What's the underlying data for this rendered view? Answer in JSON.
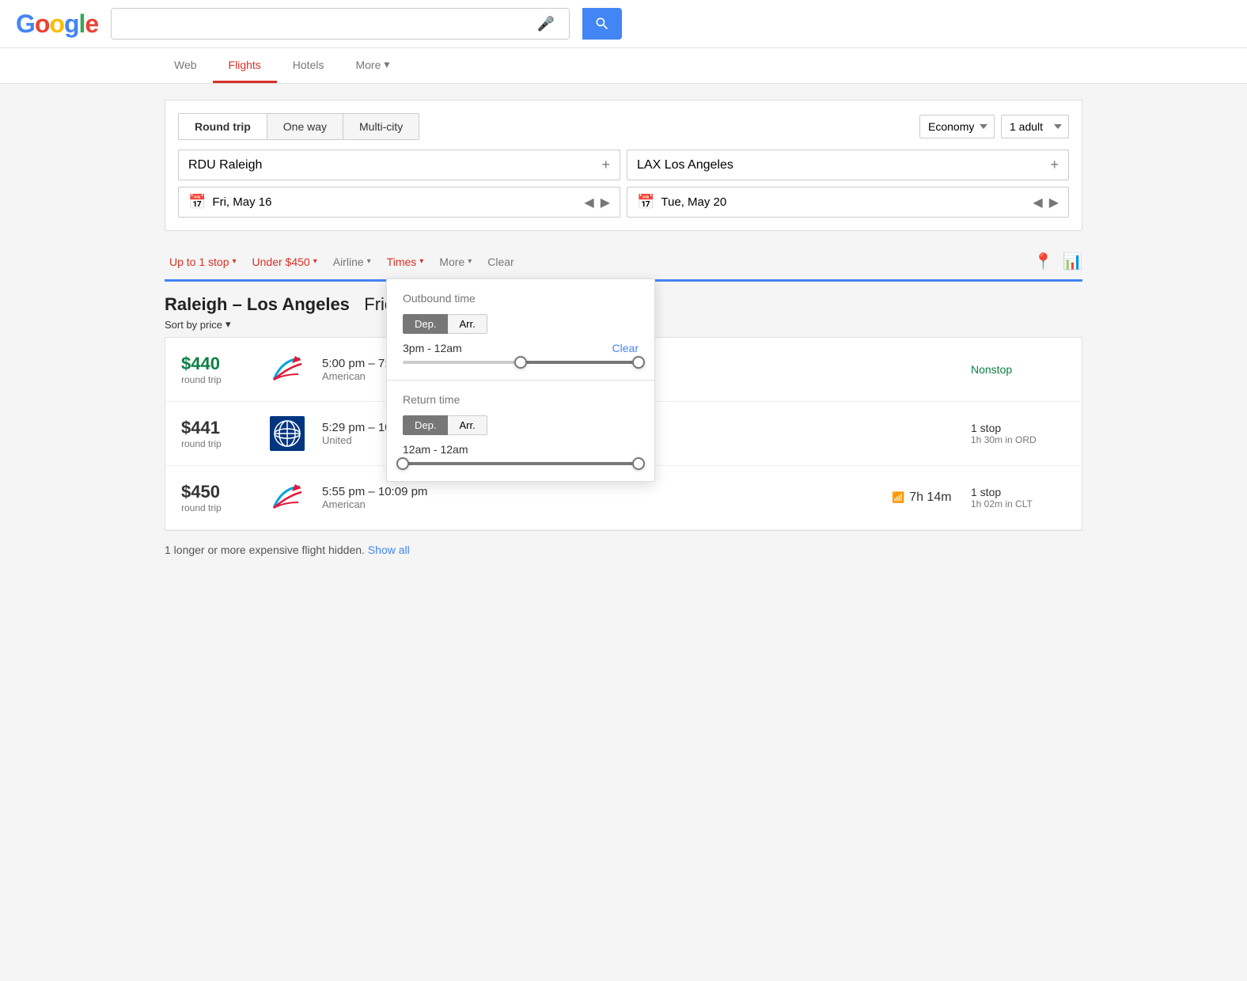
{
  "header": {
    "logo_text": "Google",
    "logo_letters": [
      "G",
      "o",
      "o",
      "g",
      "l",
      "e"
    ],
    "search_placeholder": ""
  },
  "nav": {
    "tabs": [
      {
        "label": "Web",
        "active": false
      },
      {
        "label": "Flights",
        "active": true
      },
      {
        "label": "Hotels",
        "active": false
      },
      {
        "label": "More",
        "active": false
      }
    ]
  },
  "flight_form": {
    "trip_types": [
      {
        "label": "Round trip",
        "active": true
      },
      {
        "label": "One way",
        "active": false
      },
      {
        "label": "Multi-city",
        "active": false
      }
    ],
    "cabin_class": "Economy",
    "passengers": "1 adult",
    "origin_code": "RDU",
    "origin_city": "Raleigh",
    "dest_code": "LAX",
    "dest_city": "Los Angeles",
    "depart_date": "Fri, May 16",
    "return_date": "Tue, May 20"
  },
  "filters": {
    "stops": "Up to 1 stop",
    "price": "Under $450",
    "airline": "Airline",
    "times": "Times",
    "more": "More",
    "clear": "Clear"
  },
  "results": {
    "title": "Raleigh – Los Angeles",
    "subtitle_date": "Friday",
    "sort_label": "Sort by price",
    "flights": [
      {
        "price": "$440",
        "price_type": "round trip",
        "green": true,
        "time_range": "5:00 pm – 7:30",
        "airline": "American",
        "wifi": false,
        "duration": "",
        "stops": "Nonstop",
        "stops_detail": ""
      },
      {
        "price": "$441",
        "price_type": "round trip",
        "green": false,
        "time_range": "5:29 pm – 10:4",
        "airline": "United",
        "wifi": false,
        "duration": "",
        "stops": "1 stop",
        "stops_detail": "1h 30m in ORD"
      },
      {
        "price": "$450",
        "price_type": "round trip",
        "green": false,
        "time_range": "5:55 pm – 10:09 pm",
        "airline": "American",
        "wifi": true,
        "duration": "7h 14m",
        "stops": "1 stop",
        "stops_detail": "1h 02m in CLT"
      }
    ],
    "footer_note": "1 longer or more expensive flight hidden.",
    "show_all": "Show all"
  },
  "times_popup": {
    "outbound_title": "Outbound time",
    "outbound_dep_tab": "Dep.",
    "outbound_arr_tab": "Arr.",
    "outbound_range": "3pm - 12am",
    "outbound_clear": "Clear",
    "outbound_slider_left_pct": 50,
    "outbound_slider_right_pct": 100,
    "return_title": "Return time",
    "return_dep_tab": "Dep.",
    "return_arr_tab": "Arr.",
    "return_range": "12am - 12am",
    "return_slider_left_pct": 0,
    "return_slider_right_pct": 100
  }
}
